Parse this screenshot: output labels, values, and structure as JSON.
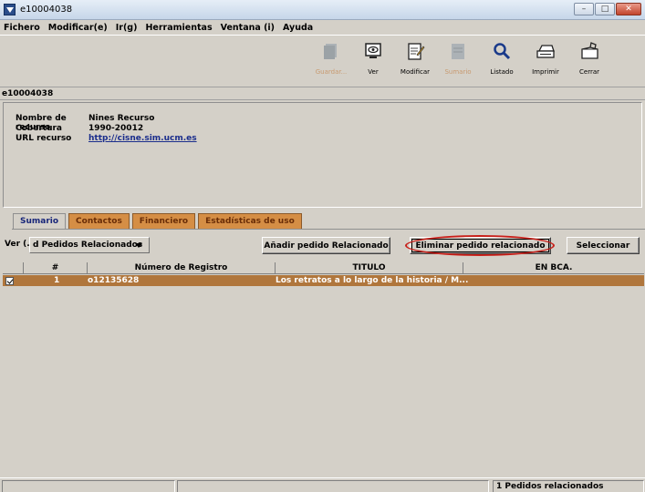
{
  "window": {
    "title": "e10004038",
    "min": "–",
    "max": "□",
    "close": "✕"
  },
  "menu": [
    "Fichero",
    "Modificar(e)",
    "Ir(g)",
    "Herramientas",
    "Ventana (i)",
    "Ayuda"
  ],
  "toolbar": {
    "guardar": "Guardar...",
    "ver": "Ver",
    "modificar": "Modificar",
    "sumario": "Sumario",
    "listado": "Listado",
    "imprimir": "Imprimir",
    "cerrar": "Cerrar"
  },
  "record_id": "e10004038",
  "info": {
    "nombre_label": "Nombre de recurso",
    "nombre_value": "Nines Recurso",
    "cobertura_label": "Cobertura",
    "cobertura_value": "1990-20012",
    "url_label": "URL recurso",
    "url_value": "http://cisne.sim.ucm.es"
  },
  "tabs": [
    "Sumario",
    "Contactos",
    "Financiero",
    "Estadísticas de uso"
  ],
  "actions": {
    "ver_label": "Ver (...",
    "view_select": "d Pedidos Relacionados",
    "add": "Añadir pedido Relacionado",
    "remove": "Eliminar pedido relacionado",
    "select": "Seleccionar"
  },
  "table": {
    "headers": [
      "#",
      "Número de Registro",
      "TITULO",
      "EN BCA."
    ],
    "rows": [
      {
        "num": "1",
        "registro": "o12135628",
        "titulo": "Los retratos a lo largo de la historia / M...",
        "enbca": ""
      }
    ]
  },
  "status": {
    "right": "1 Pedidos relacionados"
  },
  "colors": {
    "tab_inactive": "#d58e45",
    "selected_row": "#b0763c",
    "highlight_oval": "#c8201a"
  }
}
